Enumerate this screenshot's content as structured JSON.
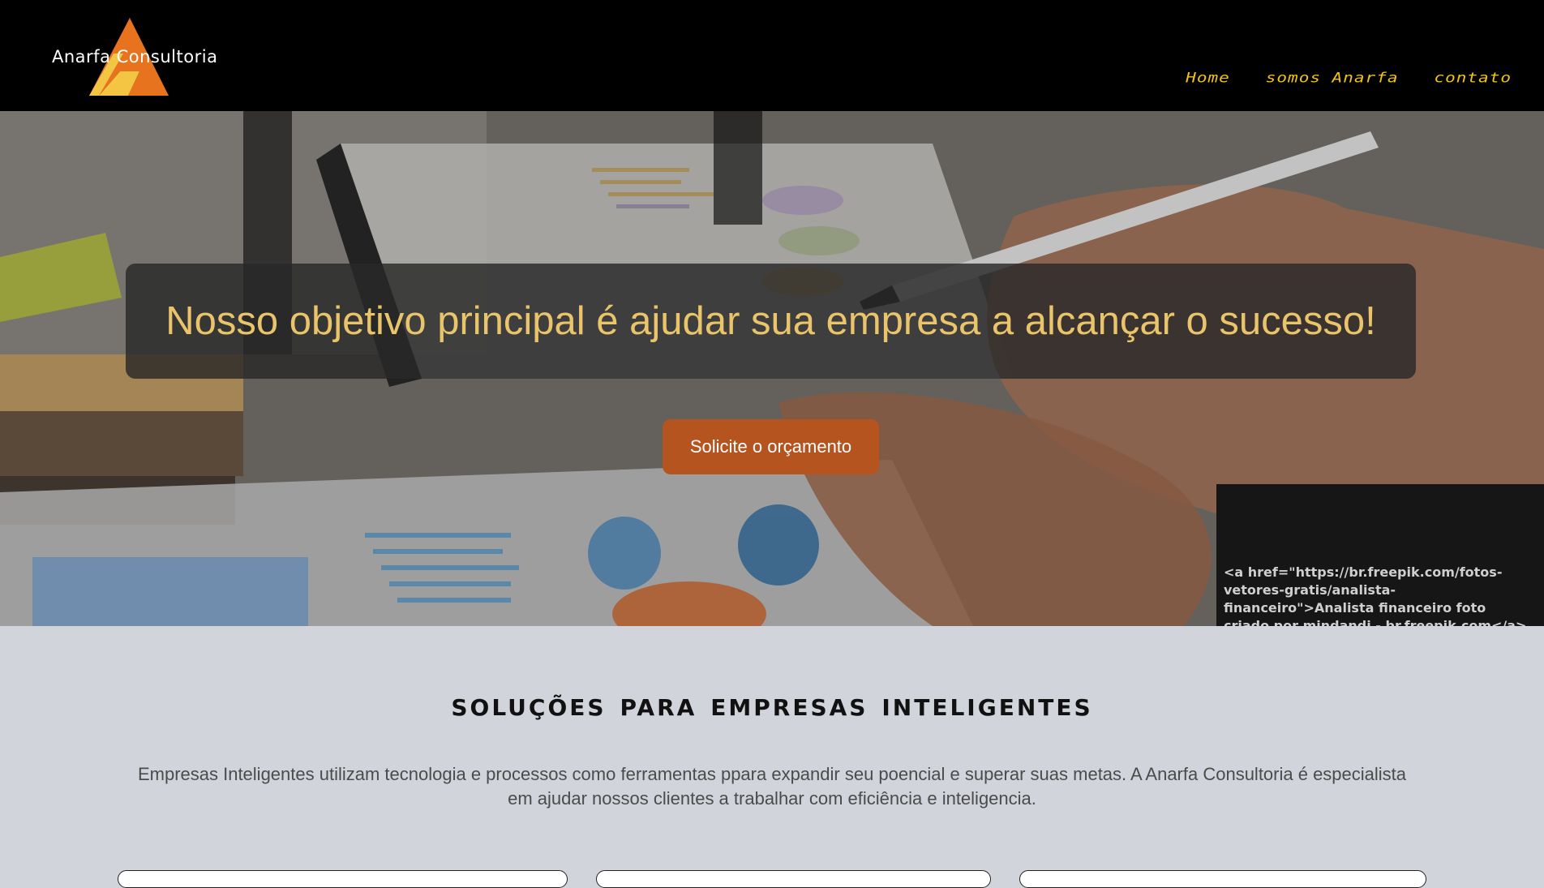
{
  "brand": {
    "name": "Anarfa Consultoria"
  },
  "nav": {
    "items": [
      "Home",
      "somos Anarfa",
      "contato"
    ]
  },
  "hero": {
    "headline": "Nosso objetivo principal é ajudar sua empresa a alcançar o sucesso!",
    "cta_label": "Solicite o orçamento",
    "credit": "<a href=\"https://br.freepik.com/fotos-vetores-gratis/analista-financeiro\">Analista financeiro foto criado por mindandi - br.freepik.com</a>"
  },
  "section": {
    "title": "soluções para empresas inteligentes",
    "text": "Empresas Inteligentes utilizam tecnologia e processos como ferramentas ppara expandir seu poencial e superar suas metas. A Anarfa Consultoria é especialista em ajudar nossos clientes a trabalhar com eficiência e inteligencia."
  },
  "colors": {
    "nav_bg": "#000000",
    "nav_link": "#f1c40f",
    "headline": "#e9c46a",
    "cta_bg": "#b5541f",
    "section_bg": "#d1d5db"
  }
}
